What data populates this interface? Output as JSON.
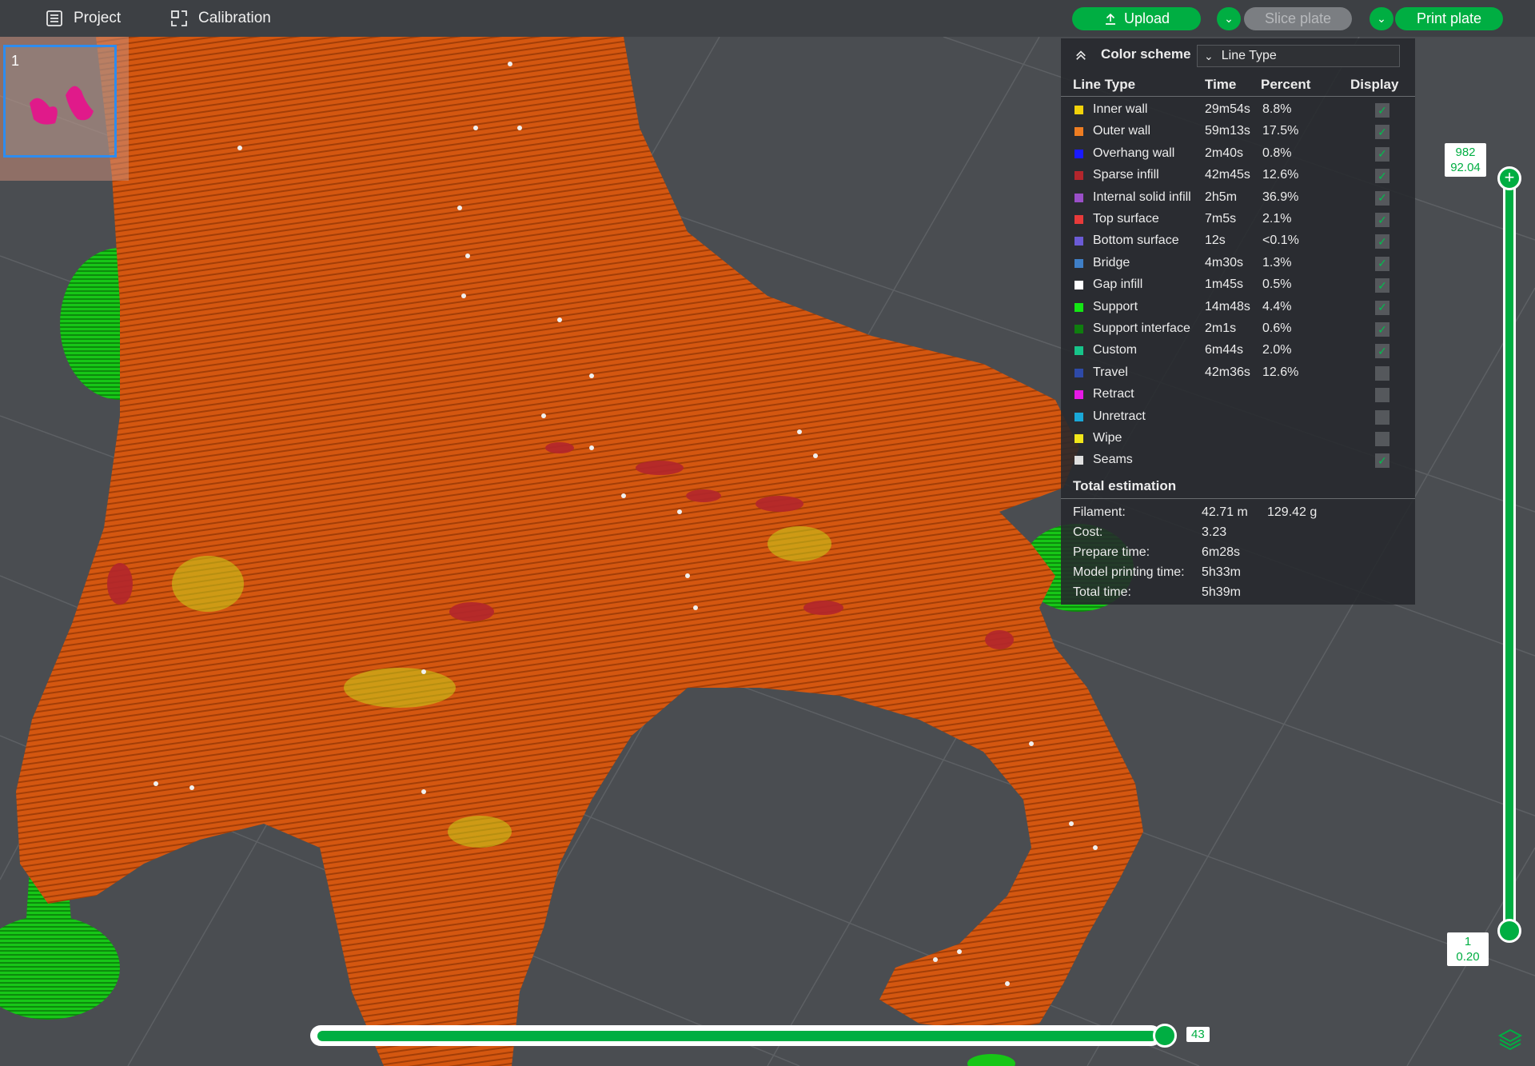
{
  "topbar": {
    "project_label": "Project",
    "calibration_label": "Calibration",
    "upload_label": "Upload",
    "slice_label": "Slice plate",
    "print_label": "Print plate"
  },
  "plate": {
    "number": "1"
  },
  "legend": {
    "title": "Color scheme",
    "scheme_value": "Line Type",
    "headers": {
      "line_type": "Line Type",
      "time": "Time",
      "percent": "Percent",
      "display": "Display"
    },
    "rows": [
      {
        "name": "Inner wall",
        "time": "29m54s",
        "percent": "8.8%",
        "color": "#f2d20a",
        "checked": true
      },
      {
        "name": "Outer wall",
        "time": "59m13s",
        "percent": "17.5%",
        "color": "#ee7d22",
        "checked": true
      },
      {
        "name": "Overhang wall",
        "time": "2m40s",
        "percent": "0.8%",
        "color": "#1a1aff",
        "checked": true
      },
      {
        "name": "Sparse infill",
        "time": "42m45s",
        "percent": "12.6%",
        "color": "#b3262c",
        "checked": true
      },
      {
        "name": "Internal solid infill",
        "time": "2h5m",
        "percent": "36.9%",
        "color": "#9a4fc8",
        "checked": true
      },
      {
        "name": "Top surface",
        "time": "7m5s",
        "percent": "2.1%",
        "color": "#e83a3a",
        "checked": true
      },
      {
        "name": "Bottom surface",
        "time": "12s",
        "percent": "<0.1%",
        "color": "#6b5bd6",
        "checked": true
      },
      {
        "name": "Bridge",
        "time": "4m30s",
        "percent": "1.3%",
        "color": "#3f7fc7",
        "checked": true
      },
      {
        "name": "Gap infill",
        "time": "1m45s",
        "percent": "0.5%",
        "color": "#ffffff",
        "checked": true
      },
      {
        "name": "Support",
        "time": "14m48s",
        "percent": "4.4%",
        "color": "#14e614",
        "checked": true
      },
      {
        "name": "Support interface",
        "time": "2m1s",
        "percent": "0.6%",
        "color": "#0f7d0f",
        "checked": true
      },
      {
        "name": "Custom",
        "time": "6m44s",
        "percent": "2.0%",
        "color": "#17c48a",
        "checked": true
      },
      {
        "name": "Travel",
        "time": "42m36s",
        "percent": "12.6%",
        "color": "#2e4aa8",
        "checked": false
      },
      {
        "name": "Retract",
        "time": "",
        "percent": "",
        "color": "#e619e6",
        "checked": false
      },
      {
        "name": "Unretract",
        "time": "",
        "percent": "",
        "color": "#1aa8d8",
        "checked": false
      },
      {
        "name": "Wipe",
        "time": "",
        "percent": "",
        "color": "#f2e61a",
        "checked": false
      },
      {
        "name": "Seams",
        "time": "",
        "percent": "",
        "color": "#e0e0e0",
        "checked": true
      }
    ],
    "total_title": "Total estimation",
    "totals": [
      {
        "label": "Filament:",
        "value": "42.71 m",
        "value2": "129.42 g"
      },
      {
        "label": "Cost:",
        "value": "3.23",
        "value2": ""
      },
      {
        "label": "Prepare time:",
        "value": "6m28s",
        "value2": ""
      },
      {
        "label": "Model printing time:",
        "value": "5h33m",
        "value2": ""
      },
      {
        "label": "Total time:",
        "value": "5h39m",
        "value2": ""
      }
    ]
  },
  "vslider": {
    "top_layer": "982",
    "top_height": "92.04",
    "bottom_layer": "1",
    "bottom_height": "0.20"
  },
  "hslider": {
    "value": "43"
  },
  "colors": {
    "accent": "#00ae42",
    "model": "#d9580f",
    "support": "#14d114",
    "background": "#4a4d51"
  }
}
